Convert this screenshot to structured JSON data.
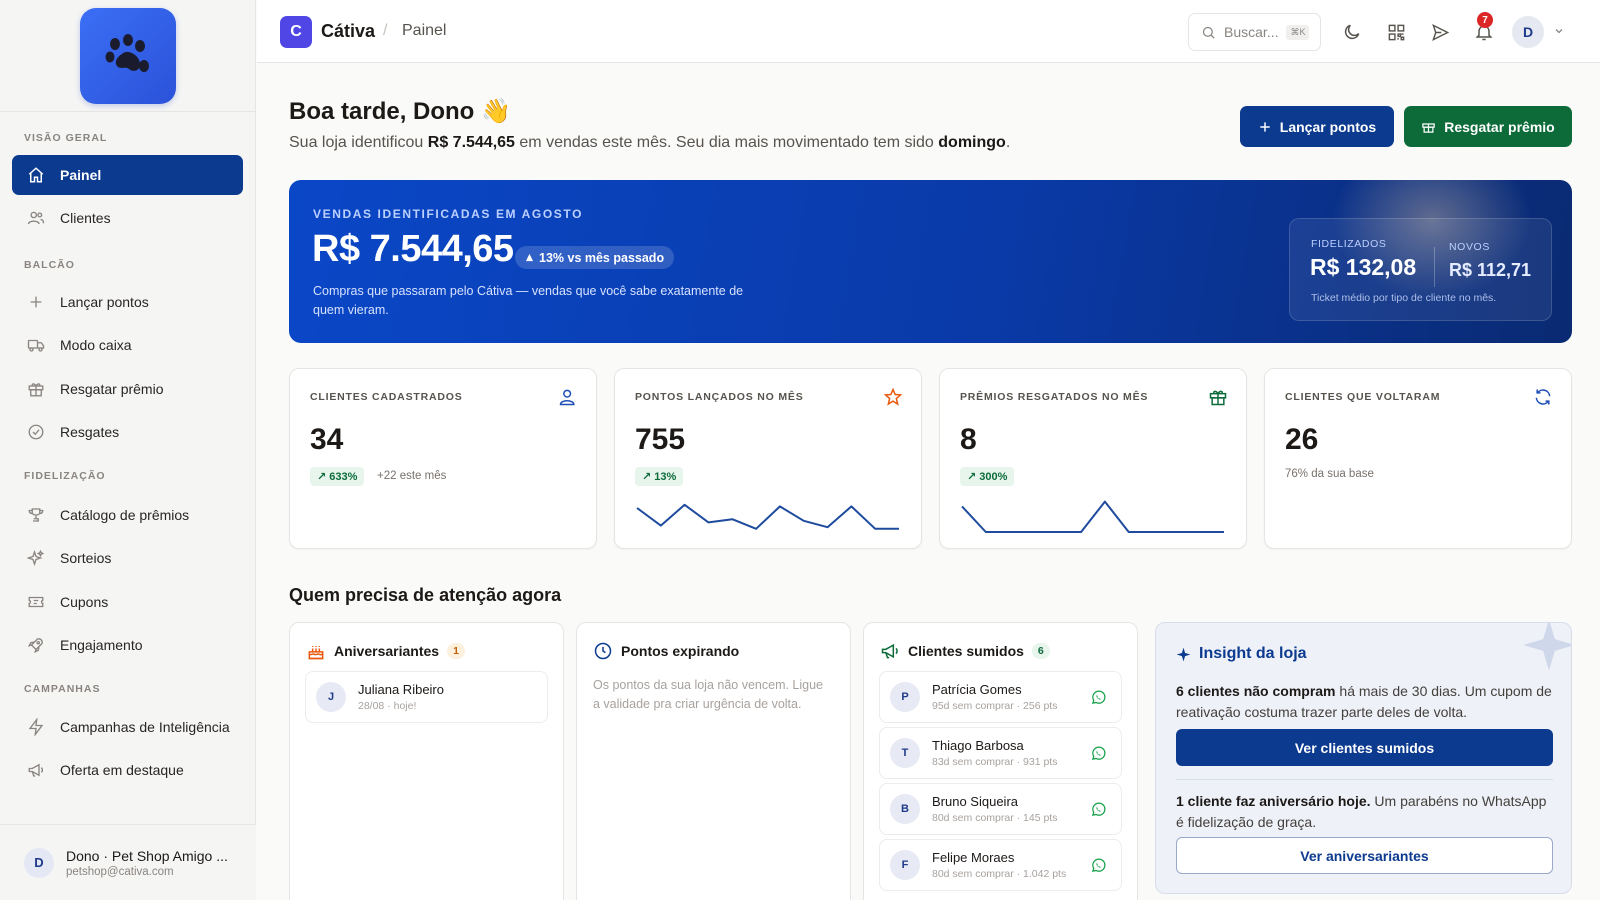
{
  "colors": {
    "primary": "#0b3a8f",
    "green": "#0d6b3a",
    "brand": "#4f46e5",
    "badge_red": "#dc2626"
  },
  "sidebar": {
    "logo_icon": "paw-icon",
    "sections": {
      "visao_geral": "VISÃO GERAL",
      "balcao": "BALCÃO",
      "fidelizacao": "FIDELIZAÇÃO",
      "campanhas": "CAMPANHAS"
    },
    "items": [
      {
        "label": "Painel",
        "icon": "home-icon",
        "active": true
      },
      {
        "label": "Clientes",
        "icon": "users-icon"
      },
      {
        "label": "Lançar pontos",
        "icon": "plus-icon"
      },
      {
        "label": "Modo caixa",
        "icon": "truck-icon"
      },
      {
        "label": "Resgatar prêmio",
        "icon": "gift-icon"
      },
      {
        "label": "Resgates",
        "icon": "check-circle-icon"
      },
      {
        "label": "Catálogo de prêmios",
        "icon": "trophy-icon"
      },
      {
        "label": "Sorteios",
        "icon": "sparkles-icon"
      },
      {
        "label": "Cupons",
        "icon": "ticket-icon"
      },
      {
        "label": "Engajamento",
        "icon": "rocket-icon"
      },
      {
        "label": "Campanhas de Inteligência",
        "icon": "bolt-icon"
      },
      {
        "label": "Oferta em destaque",
        "icon": "megaphone-icon"
      }
    ],
    "footer": {
      "avatar": "D",
      "name": "Dono · Pet Shop Amigo ...",
      "email": "petshop@cativa.com"
    }
  },
  "topbar": {
    "brand_letter": "C",
    "brand_name": "Cátiva",
    "separator": "/",
    "breadcrumb": "Painel",
    "search_placeholder": "Buscar...",
    "search_shortcut": "⌘K",
    "notifications": "7",
    "avatar": "D"
  },
  "greeting": {
    "title": "Boa tarde, Dono 👋",
    "sub_pre": "Sua loja identificou ",
    "sub_amount": "R$ 7.544,65",
    "sub_mid": " em vendas este mês. Seu dia mais movimentado tem sido ",
    "sub_day": "domingo",
    "sub_end": "."
  },
  "actions": {
    "launch_points": "Lançar pontos",
    "redeem_prize": "Resgatar prêmio"
  },
  "hero": {
    "label": "VENDAS IDENTIFICADAS EM AGOSTO",
    "value": "R$ 7.544,65",
    "badge": "13% vs mês passado",
    "desc": "Compras que passaram pelo Cátiva — vendas que você sabe exatamente de quem vieram.",
    "loyal_label": "FIDELIZADOS",
    "loyal_value": "R$ 132,08",
    "new_label": "NOVOS",
    "new_value": "R$ 112,71",
    "card_foot": "Ticket médio por tipo de cliente no mês."
  },
  "stats": [
    {
      "label": "CLIENTES CADASTRADOS",
      "icon": "user-icon",
      "value": "34",
      "chip": "633%",
      "note": "+22 este mês"
    },
    {
      "label": "PONTOS LANÇADOS NO MÊS",
      "icon": "star-icon",
      "value": "755",
      "chip": "13%",
      "spark": [
        0.75,
        0.2,
        0.85,
        0.3,
        0.4,
        0.1,
        0.8,
        0.35,
        0.15,
        0.8,
        0.1,
        0.1
      ]
    },
    {
      "label": "PRÊMIOS RESGATADOS NO MÊS",
      "icon": "gift-icon",
      "value": "8",
      "chip": "300%",
      "spark": [
        0.8,
        0.0,
        0.0,
        0.0,
        0.0,
        0.0,
        0.95,
        0.0,
        0.0,
        0.0,
        0.0,
        0.0
      ]
    },
    {
      "label": "CLIENTES QUE VOLTARAM",
      "icon": "refresh-icon",
      "value": "26",
      "note": "76% da sua base"
    }
  ],
  "attention": {
    "title": "Quem precisa de atenção agora",
    "birthdays": {
      "title": "Aniversariantes",
      "count": "1",
      "people": [
        {
          "initial": "J",
          "name": "Juliana Ribeiro",
          "meta": "28/08 · hoje!"
        }
      ]
    },
    "expiring": {
      "title": "Pontos expirando",
      "empty": "Os pontos da sua loja não vencem. Ligue a validade pra criar urgência de volta."
    },
    "missing": {
      "title": "Clientes sumidos",
      "count": "6",
      "people": [
        {
          "initial": "P",
          "name": "Patrícia Gomes",
          "meta": "95d sem comprar · 256 pts"
        },
        {
          "initial": "T",
          "name": "Thiago Barbosa",
          "meta": "83d sem comprar · 931 pts"
        },
        {
          "initial": "B",
          "name": "Bruno Siqueira",
          "meta": "80d sem comprar · 145 pts"
        },
        {
          "initial": "F",
          "name": "Felipe Moraes",
          "meta": "80d sem comprar · 1.042 pts"
        }
      ]
    },
    "insight": {
      "title": "Insight da loja",
      "p1_bold": "6 clientes não compram",
      "p1_rest": " há mais de 30 dias. Um cupom de reativação costuma trazer parte deles de volta.",
      "btn1": "Ver clientes sumidos",
      "p2_bold": "1 cliente faz aniversário hoje.",
      "p2_rest": " Um parabéns no WhatsApp é fidelização de graça.",
      "btn2": "Ver aniversariantes"
    }
  }
}
